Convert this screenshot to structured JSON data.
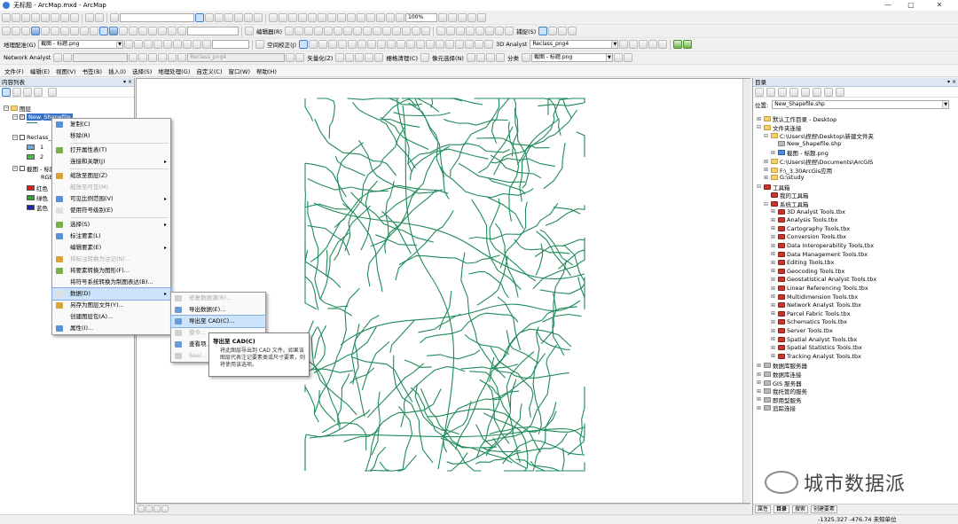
{
  "window": {
    "title": "无标题 - ArcMap.mxd - ArcMap",
    "minimize": "—",
    "maximize": "▢",
    "close": "✕"
  },
  "toolbar1": {
    "scale_value": "",
    "zoom_value": "100%"
  },
  "toolbar2": {
    "layout_label": "地理配准(G)",
    "layout_combo": "截图 - 标题.png",
    "editor_label": "编辑器(R)",
    "spatial_adjust_label": "空间校正(J)",
    "analyst3d_label": "3D Analyst",
    "reclass_combo": "Reclass_png4",
    "snap_label": "捕捉(S)"
  },
  "toolbar3": {
    "network_analyst_label": "Network Analyst",
    "reclass_combo_disabled": "Reclass_png4",
    "vectorize_label": "矢量化(Z)",
    "raster_cleanup_label": "栅格清理(C)",
    "cell_selection_label": "像元选择(N)",
    "classify_label": "分类",
    "image_combo": "截图 - 标题.png"
  },
  "menubar": {
    "items": [
      "文件(F)",
      "编辑(E)",
      "视图(V)",
      "书签(B)",
      "插入(I)",
      "选择(S)",
      "地理处理(G)",
      "自定义(C)",
      "窗口(W)",
      "帮助(H)"
    ]
  },
  "toc": {
    "title": "内容列表",
    "pin": "▾ ×",
    "layers_root": "图层",
    "layer_selected": "New_Shapefile",
    "reclass_layer": "Reclass_png4",
    "reclass_values": [
      "1",
      "2"
    ],
    "image_layer": "截图 - 标题.png",
    "rgb_label": "RGB",
    "bands": [
      "红色",
      "绿色",
      "蓝色"
    ],
    "band_colors": [
      "#e31a1c",
      "#33a02c",
      "#1f1fb4"
    ],
    "reclass_colors": [
      "#6fa9e0",
      "#4cba4c"
    ]
  },
  "context_menu": {
    "items": [
      {
        "label": "复制(C)",
        "disabled": false,
        "submenu": false
      },
      {
        "label": "移除(R)",
        "disabled": false,
        "submenu": false
      },
      {
        "sep": true
      },
      {
        "label": "打开属性表(T)",
        "disabled": false,
        "submenu": false
      },
      {
        "label": "连接和关联(J)",
        "disabled": false,
        "submenu": true
      },
      {
        "sep": true
      },
      {
        "label": "缩放至图层(Z)",
        "disabled": false,
        "submenu": false
      },
      {
        "label": "缩放至可见(M)",
        "disabled": true,
        "submenu": false
      },
      {
        "label": "可见比例范围(V)",
        "disabled": false,
        "submenu": true
      },
      {
        "label": "使用符号级别(E)",
        "disabled": false,
        "submenu": false
      },
      {
        "sep": true
      },
      {
        "label": "选择(S)",
        "disabled": false,
        "submenu": true
      },
      {
        "label": "标注要素(L)",
        "disabled": false,
        "submenu": false
      },
      {
        "label": "编辑要素(E)",
        "disabled": false,
        "submenu": true
      },
      {
        "label": "将标注转换为注记(N)...",
        "disabled": true,
        "submenu": false
      },
      {
        "label": "将要素转换为图形(F)...",
        "disabled": false,
        "submenu": false
      },
      {
        "label": "将符号系统转换为制图表达(B)...",
        "disabled": false,
        "submenu": false
      },
      {
        "label": "数据(D)",
        "disabled": false,
        "submenu": true,
        "highlight": true
      },
      {
        "label": "另存为图层文件(Y)...",
        "disabled": false,
        "submenu": false
      },
      {
        "label": "创建图层包(A)...",
        "disabled": false,
        "submenu": false
      },
      {
        "label": "属性(I)...",
        "disabled": false,
        "submenu": false
      }
    ]
  },
  "data_submenu": {
    "items": [
      {
        "label": "修复数据源(R)...",
        "disabled": true
      },
      {
        "label": "导出数据(E)...",
        "disabled": false
      },
      {
        "label": "导出至 CAD(C)...",
        "disabled": false,
        "highlight": true
      },
      {
        "label": "使今...",
        "disabled": true
      },
      {
        "label": "查看项...",
        "disabled": false
      },
      {
        "label": "See/...",
        "disabled": true
      }
    ]
  },
  "tooltip": {
    "title": "导出至 CAD(C)",
    "body": "将此图层导出到 CAD 文件。如果该图层代表注记要素类或尺寸要素，则将使用该选项。"
  },
  "catalog": {
    "title": "目录",
    "location_label": "位置:",
    "location_value": "New_Shapefile.shp",
    "tree": [
      {
        "label": "默认工作目录 - Desktop",
        "indent": 0,
        "icon": "folder",
        "exp": "⊞"
      },
      {
        "label": "文件夹连接",
        "indent": 0,
        "icon": "folder",
        "exp": "⊟"
      },
      {
        "label": "C:\\Users\\捏捏\\Desktop\\新建文件夹",
        "indent": 1,
        "icon": "folder",
        "exp": "⊟"
      },
      {
        "label": "New_Shapefile.shp",
        "indent": 2,
        "icon": "gray",
        "exp": ""
      },
      {
        "label": "截图 - 标题.png",
        "indent": 2,
        "icon": "blue",
        "exp": "⊞"
      },
      {
        "label": "C:\\Users\\捏捏\\Documents\\ArcGIS",
        "indent": 1,
        "icon": "folder",
        "exp": "⊞"
      },
      {
        "label": "F:\\_3.30ArcGis应用",
        "indent": 1,
        "icon": "folder",
        "exp": "⊞"
      },
      {
        "label": "G:\\study",
        "indent": 1,
        "icon": "folder",
        "exp": "⊞"
      },
      {
        "label": "工具箱",
        "indent": 0,
        "icon": "tbx",
        "exp": "⊟"
      },
      {
        "label": "我的工具箱",
        "indent": 1,
        "icon": "tbx",
        "exp": ""
      },
      {
        "label": "系统工具箱",
        "indent": 1,
        "icon": "tbx",
        "exp": "⊟"
      },
      {
        "label": "3D Analyst Tools.tbx",
        "indent": 2,
        "icon": "tbx",
        "exp": "⊞"
      },
      {
        "label": "Analysis Tools.tbx",
        "indent": 2,
        "icon": "tbx",
        "exp": "⊞"
      },
      {
        "label": "Cartography Tools.tbx",
        "indent": 2,
        "icon": "tbx",
        "exp": "⊞"
      },
      {
        "label": "Conversion Tools.tbx",
        "indent": 2,
        "icon": "tbx",
        "exp": "⊞"
      },
      {
        "label": "Data Interoperability Tools.tbx",
        "indent": 2,
        "icon": "tbx",
        "exp": "⊞"
      },
      {
        "label": "Data Management Tools.tbx",
        "indent": 2,
        "icon": "tbx",
        "exp": "⊞"
      },
      {
        "label": "Editing Tools.tbx",
        "indent": 2,
        "icon": "tbx",
        "exp": "⊞"
      },
      {
        "label": "Geocoding Tools.tbx",
        "indent": 2,
        "icon": "tbx",
        "exp": "⊞"
      },
      {
        "label": "Geostatistical Analyst Tools.tbx",
        "indent": 2,
        "icon": "tbx",
        "exp": "⊞"
      },
      {
        "label": "Linear Referencing Tools.tbx",
        "indent": 2,
        "icon": "tbx",
        "exp": "⊞"
      },
      {
        "label": "Multidimension Tools.tbx",
        "indent": 2,
        "icon": "tbx",
        "exp": "⊞"
      },
      {
        "label": "Network Analyst Tools.tbx",
        "indent": 2,
        "icon": "tbx",
        "exp": "⊞"
      },
      {
        "label": "Parcel Fabric Tools.tbx",
        "indent": 2,
        "icon": "tbx",
        "exp": "⊞"
      },
      {
        "label": "Schematics Tools.tbx",
        "indent": 2,
        "icon": "tbx",
        "exp": "⊞"
      },
      {
        "label": "Server Tools.tbx",
        "indent": 2,
        "icon": "tbx",
        "exp": "⊞"
      },
      {
        "label": "Spatial Analyst Tools.tbx",
        "indent": 2,
        "icon": "tbx",
        "exp": "⊞"
      },
      {
        "label": "Spatial Statistics Tools.tbx",
        "indent": 2,
        "icon": "tbx",
        "exp": "⊞"
      },
      {
        "label": "Tracking Analyst Tools.tbx",
        "indent": 2,
        "icon": "tbx",
        "exp": "⊞"
      },
      {
        "label": "数据库服务器",
        "indent": 0,
        "icon": "gray",
        "exp": "⊞"
      },
      {
        "label": "数据库连接",
        "indent": 0,
        "icon": "gray",
        "exp": "⊞"
      },
      {
        "label": "GIS 服务器",
        "indent": 0,
        "icon": "gray",
        "exp": "⊞"
      },
      {
        "label": "我托管的服务",
        "indent": 0,
        "icon": "gray",
        "exp": "⊞"
      },
      {
        "label": "即用型服务",
        "indent": 0,
        "icon": "gray",
        "exp": "⊞"
      },
      {
        "label": "追踪连接",
        "indent": 0,
        "icon": "gray",
        "exp": "⊞"
      }
    ],
    "footer_tabs": [
      "属性",
      "目录",
      "搜索",
      "创建要素"
    ]
  },
  "statusbar": {
    "coords": "-1325.327  -476.74 未知单位"
  },
  "watermark": {
    "text": "城市数据派"
  },
  "map": {
    "road_color": "#1f8a5a"
  }
}
